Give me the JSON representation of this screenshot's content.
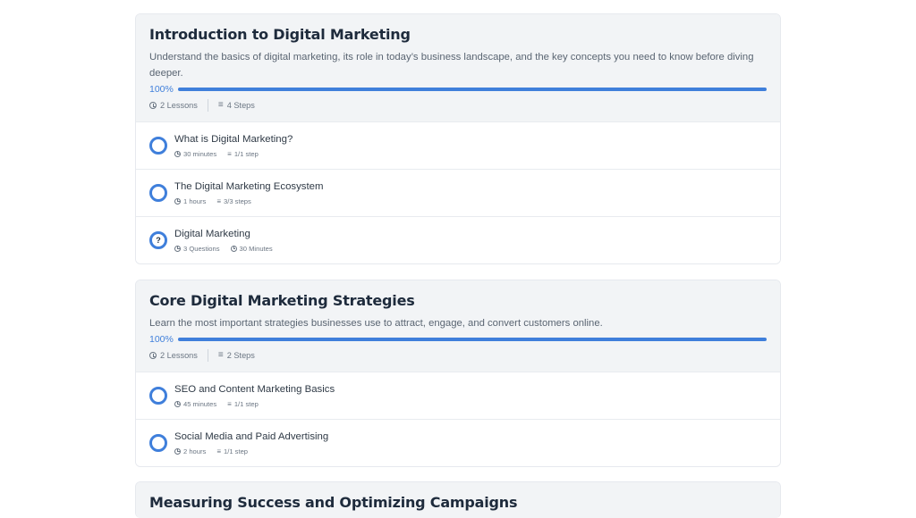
{
  "modules": [
    {
      "title": "Introduction to Digital Marketing",
      "description": "Understand the basics of digital marketing, its role in today’s business landscape, and the key concepts you need to know before diving deeper.",
      "progress_label": "100%",
      "progress": 100,
      "lessons_count": "2 Lessons",
      "steps_count": "4 Steps",
      "items": [
        {
          "title": "What is Digital Marketing?",
          "meta1": "30 minutes",
          "meta2": "1/1 step",
          "type": "lesson"
        },
        {
          "title": "The Digital Marketing Ecosystem",
          "meta1": "1 hours",
          "meta2": "3/3 steps",
          "type": "lesson"
        },
        {
          "title": "Digital Marketing",
          "meta1": "3 Questions",
          "meta2": "30 Minutes",
          "type": "quiz",
          "badge": "?"
        }
      ]
    },
    {
      "title": "Core Digital Marketing Strategies",
      "description": "Learn the most important strategies businesses use to attract, engage, and convert customers online.",
      "progress_label": "100%",
      "progress": 100,
      "lessons_count": "2 Lessons",
      "steps_count": "2 Steps",
      "items": [
        {
          "title": "SEO and Content Marketing Basics",
          "meta1": "45 minutes",
          "meta2": "1/1 step",
          "type": "lesson"
        },
        {
          "title": "Social Media and Paid Advertising",
          "meta1": "2 hours",
          "meta2": "1/1 step",
          "type": "lesson"
        }
      ]
    },
    {
      "title": "Measuring Success and Optimizing Campaigns"
    }
  ],
  "colors": {
    "accent": "#3f7fdb",
    "header_bg": "#f2f4f6",
    "title": "#1e2b3c"
  },
  "icons": {
    "duration": "clock-icon",
    "steps": "list-icon",
    "complete": "progress-ring-icon",
    "quiz": "quiz-icon"
  }
}
